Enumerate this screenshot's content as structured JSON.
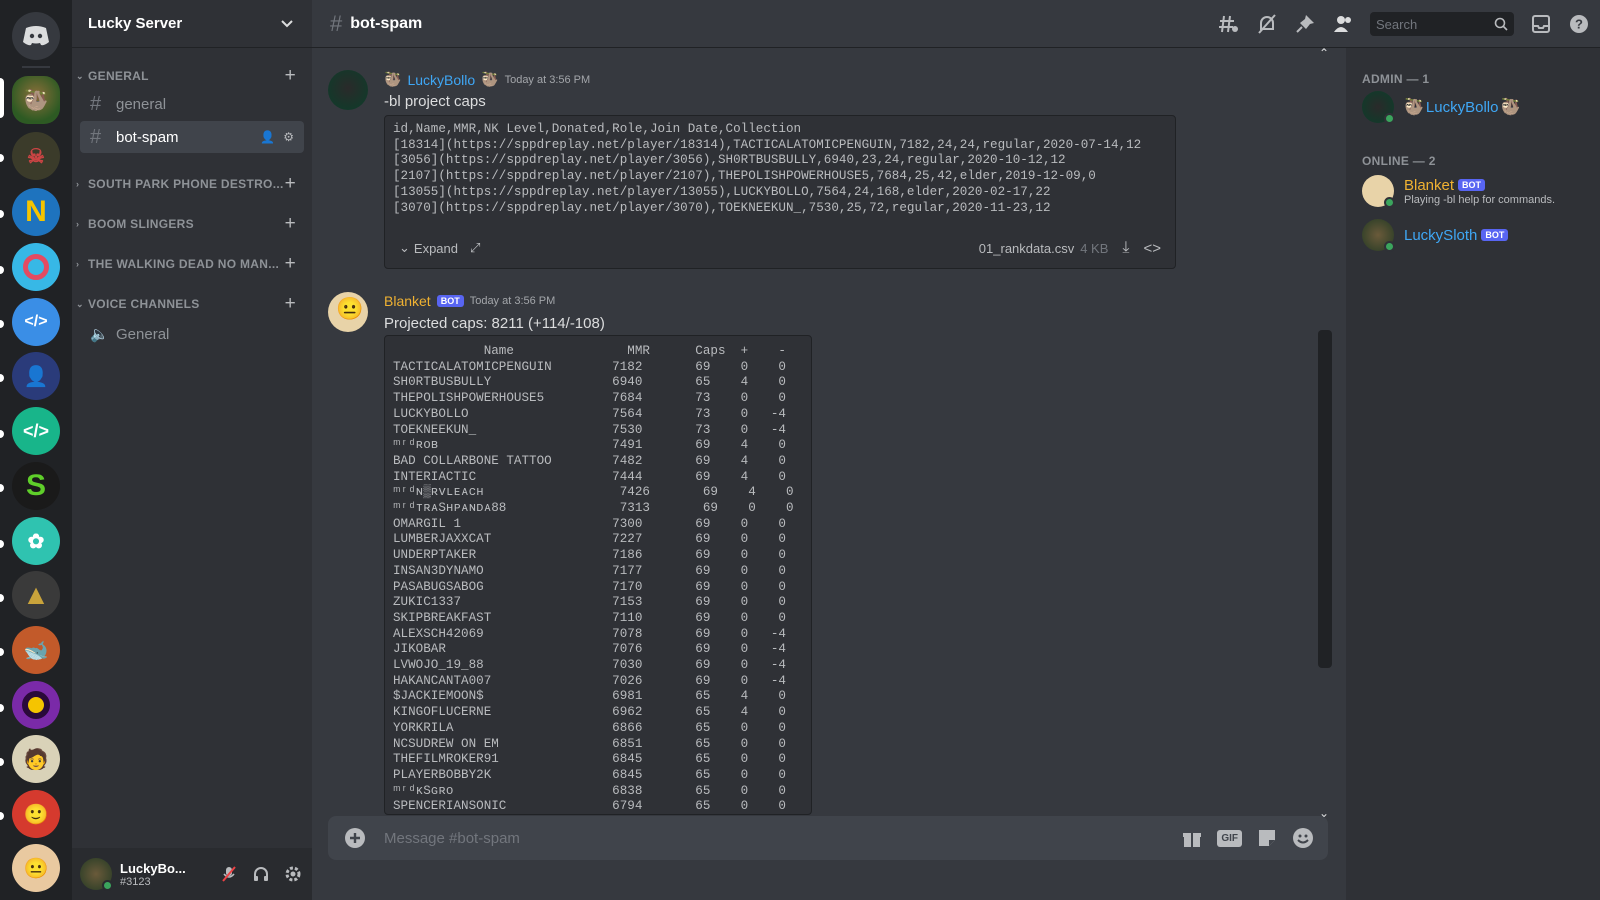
{
  "server": {
    "name": "Lucky Server",
    "categories": [
      {
        "label": "General"
      },
      {
        "label": "South Park Phone Destro..."
      },
      {
        "label": "Boom Slingers"
      },
      {
        "label": "The Walking Dead No Man..."
      },
      {
        "label": "Voice Channels"
      }
    ],
    "channels": {
      "general": "general",
      "bot_spam": "bot-spam",
      "voice_general": "General"
    }
  },
  "user": {
    "name": "LuckyBo...",
    "tag": "#3123"
  },
  "channel": {
    "title": "bot-spam",
    "search_placeholder": "Search"
  },
  "messages": [
    {
      "author": "LuckyBollo",
      "author_color": "#3fa7f5",
      "timestamp": "Today at 3:56 PM",
      "text": "-bl project caps",
      "code": "id,Name,MMR,NK Level,Donated,Role,Join Date,Collection\n[18314](https://sppdreplay.net/player/18314),TACTICALATOMICPENGUIN,7182,24,24,regular,2020-07-14,12\n[3056](https://sppdreplay.net/player/3056),SH0RTBUSBULLY,6940,23,24,regular,2020-10-12,12\n[2107](https://sppdreplay.net/player/2107),THEPOLISHPOWERHOUSE5,7684,25,42,elder,2019-12-09,0\n[13055](https://sppdreplay.net/player/13055),LUCKYBOLLO,7564,24,168,elder,2020-02-17,22\n[3070](https://sppdreplay.net/player/3070),TOEKNEEKUN_,7530,25,72,regular,2020-11-23,12",
      "expand_label": "Expand",
      "file_name": "01_rankdata.csv",
      "file_size": "4 KB"
    },
    {
      "author": "Blanket",
      "author_color": "#f0b232",
      "bot_badge": "BOT",
      "timestamp": "Today at 3:56 PM",
      "text": "Projected caps: 8211 (+114/-108)",
      "table": "            Name               MMR      Caps  +    -\nTACTICALATOMICPENGUIN        7182       69    0    0\nSH0RTBUSBULLY                6940       65    4    0\nTHEPOLISHPOWERHOUSE5         7684       73    0    0\nLUCKYBOLLO                   7564       73    0   -4\nTOEKNEEKUN_                  7530       73    0   -4\nᵐʳᵈʀᴏʙ                       7491       69    4    0\nBAD COLLARBONE TATTOO        7482       69    4    0\nINTERIACTIC                  7444       69    4    0\nᵐʳᵈɴ▒ʀᴠʟᴇᴀᴄʜ                  7426       69    4    0\nᵐʳᵈᴛʀᴀSʜᴘᴀɴᴅᴀ88               7313       69    0    0\nOMARGIL 1                    7300       69    0    0\nLUMBERJAXXCAT                7227       69    0    0\nUNDERPTAKER                  7186       69    0    0\nINSAN3DYNAMO                 7177       69    0    0\nPASABUGSABOG                 7170       69    0    0\nZUKIC1337                    7153       69    0    0\nSKIPBREAKFAST                7110       69    0    0\nALEXSCH42069                 7078       69    0   -4\nJIKOBAR                      7076       69    0   -4\nLVWOJO_19_88                 7030       69    0   -4\nHAKANCANTA007                7026       69    0   -4\n$JACKIEMOON$                 6981       65    4    0\nKINGOFLUCERNE                6962       65    4    0\nYORKRILA                     6866       65    0    0\nNCSUDREW ON EM               6851       65    0    0\nTHEFILMROKER91               6845       65    0    0\nPLAYERBOBBY2K                6845       65    0    0\nᵐʳᵈᴋSɢʀᴏ                     6838       65    0    0\nSPENCERIANSONIC              6794       65    0    0"
    }
  ],
  "composer": {
    "placeholder": "Message #bot-spam",
    "gif_label": "GIF"
  },
  "members": {
    "groups": [
      {
        "label": "Admin — 1"
      },
      {
        "label": "Online — 2"
      }
    ],
    "list": [
      {
        "name": "LuckyBollo",
        "color": "#3fa7f5"
      },
      {
        "name": "Blanket",
        "color": "#f0b232",
        "badge": "BOT",
        "status": "Playing -bl help for commands."
      },
      {
        "name": "LuckySloth",
        "color": "#3fa7f5",
        "badge": "BOT"
      }
    ]
  },
  "colors": {
    "accent": "#5865f2",
    "online": "#3ba55d"
  }
}
